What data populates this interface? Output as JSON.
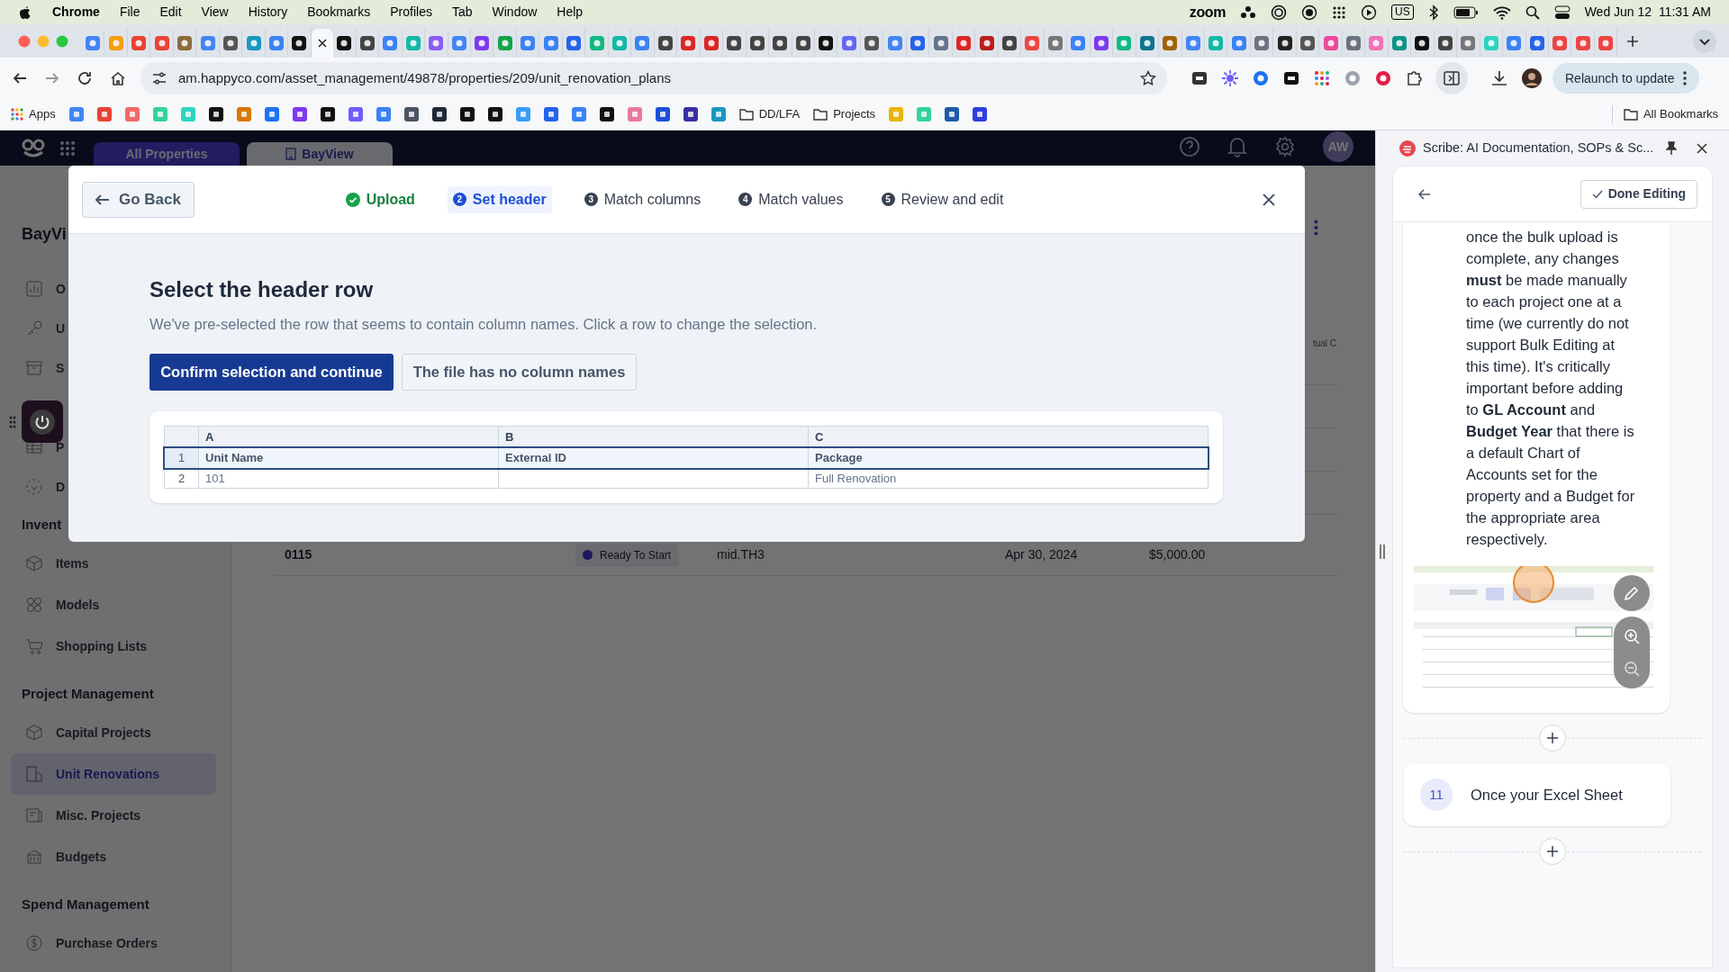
{
  "menu_bar": {
    "app": "Chrome",
    "items": [
      "File",
      "Edit",
      "View",
      "History",
      "Bookmarks",
      "Profiles",
      "Tab",
      "Window",
      "Help"
    ],
    "zoom": "zoom",
    "input_source": "US",
    "clock": "Wed Jun 12  11:31 AM"
  },
  "browser": {
    "tabs": [
      {
        "selected": false,
        "color": "#4285f4"
      },
      {
        "selected": false,
        "color": "#f59e0b"
      },
      {
        "selected": false,
        "color": "#ea4335"
      },
      {
        "selected": false,
        "color": "#ea4335"
      },
      {
        "selected": false,
        "color": "#8b6b3d"
      },
      {
        "selected": false,
        "color": "#4285f4"
      },
      {
        "selected": false,
        "color": "#555555"
      },
      {
        "selected": false,
        "color": "#1798c1"
      },
      {
        "selected": false,
        "color": "#3b82f6"
      },
      {
        "selected": false,
        "color": "#111111"
      },
      {
        "selected": true
      },
      {
        "selected": false,
        "color": "#111111"
      },
      {
        "selected": false,
        "color": "#444444"
      },
      {
        "selected": false,
        "color": "#3b82f6"
      },
      {
        "selected": false,
        "color": "#14b8a6"
      },
      {
        "selected": false,
        "color": "#8b5cf6"
      },
      {
        "selected": false,
        "color": "#4285f4"
      },
      {
        "selected": false,
        "color": "#7c3aed"
      },
      {
        "selected": false,
        "color": "#16a34a"
      },
      {
        "selected": false,
        "color": "#3b82f6"
      },
      {
        "selected": false,
        "color": "#3b82f6"
      },
      {
        "selected": false,
        "color": "#2563eb"
      },
      {
        "selected": false,
        "color": "#10b981"
      },
      {
        "selected": false,
        "color": "#14b8a6"
      },
      {
        "selected": false,
        "color": "#3b82f6"
      },
      {
        "selected": false,
        "color": "#444444"
      },
      {
        "selected": false,
        "color": "#dc2626"
      },
      {
        "selected": false,
        "color": "#dc2626"
      },
      {
        "selected": false,
        "color": "#444444"
      },
      {
        "selected": false,
        "color": "#444444"
      },
      {
        "selected": false,
        "color": "#444444"
      },
      {
        "selected": false,
        "color": "#444444"
      },
      {
        "selected": false,
        "color": "#111111"
      },
      {
        "selected": false,
        "color": "#6366f1"
      },
      {
        "selected": false,
        "color": "#555555"
      },
      {
        "selected": false,
        "color": "#4285f4"
      },
      {
        "selected": false,
        "color": "#2563eb"
      },
      {
        "selected": false,
        "color": "#64748b"
      },
      {
        "selected": false,
        "color": "#dc2626"
      },
      {
        "selected": false,
        "color": "#b91c1c"
      },
      {
        "selected": false,
        "color": "#444444"
      },
      {
        "selected": false,
        "color": "#ef4444"
      },
      {
        "selected": false,
        "color": "#777777"
      },
      {
        "selected": false,
        "color": "#3b82f6"
      },
      {
        "selected": false,
        "color": "#7c3aed"
      },
      {
        "selected": false,
        "color": "#10b981"
      },
      {
        "selected": false,
        "color": "#0e7490"
      },
      {
        "selected": false,
        "color": "#a16207"
      },
      {
        "selected": false,
        "color": "#4285f4"
      },
      {
        "selected": false,
        "color": "#14b8a6"
      },
      {
        "selected": false,
        "color": "#3b82f6"
      },
      {
        "selected": false,
        "color": "#6b7280"
      },
      {
        "selected": false,
        "color": "#222222"
      },
      {
        "selected": false,
        "color": "#555555"
      },
      {
        "selected": false,
        "color": "#ec4899"
      },
      {
        "selected": false,
        "color": "#6b7280"
      },
      {
        "selected": false,
        "color": "#f472b6"
      },
      {
        "selected": false,
        "color": "#0d9488"
      },
      {
        "selected": false,
        "color": "#111111"
      },
      {
        "selected": false,
        "color": "#444444"
      },
      {
        "selected": false,
        "color": "#777777"
      },
      {
        "selected": false,
        "color": "#2dd4bf"
      },
      {
        "selected": false,
        "color": "#3b82f6"
      },
      {
        "selected": false,
        "color": "#2563eb"
      },
      {
        "selected": false,
        "color": "#ef4444"
      },
      {
        "selected": false,
        "color": "#ef4444"
      },
      {
        "selected": false,
        "color": "#ef4444"
      }
    ],
    "url": "am.happyco.com/asset_management/49878/properties/209/unit_renovation_plans",
    "relaunch": "Relaunch to update",
    "bookmarks": [
      {
        "kind": "apps",
        "label": "Apps"
      },
      {
        "kind": "icon",
        "color": "#4285f4"
      },
      {
        "kind": "icon",
        "color": "#ea4335"
      },
      {
        "kind": "icon",
        "color": "#f06a6a"
      },
      {
        "kind": "icon",
        "color": "#34d399"
      },
      {
        "kind": "icon",
        "color": "#2dd4bf"
      },
      {
        "kind": "icon",
        "color": "#111111"
      },
      {
        "kind": "icon",
        "color": "#d97706"
      },
      {
        "kind": "icon",
        "color": "#1d72f3"
      },
      {
        "kind": "icon",
        "color": "#7c3aed"
      },
      {
        "kind": "icon",
        "color": "#111111"
      },
      {
        "kind": "icon",
        "color": "#6d5dfc"
      },
      {
        "kind": "icon",
        "color": "#3b82f6"
      },
      {
        "kind": "icon",
        "color": "#4b5563"
      },
      {
        "kind": "icon",
        "color": "#1f2937"
      },
      {
        "kind": "icon",
        "color": "#111111"
      },
      {
        "kind": "icon",
        "color": "#111111"
      },
      {
        "kind": "icon",
        "color": "#3b9df8"
      },
      {
        "kind": "icon",
        "color": "#2563eb"
      },
      {
        "kind": "icon",
        "color": "#3b82f6"
      },
      {
        "kind": "icon",
        "color": "#111111"
      },
      {
        "kind": "icon",
        "color": "#e879a0"
      },
      {
        "kind": "icon",
        "color": "#1d4ed8"
      },
      {
        "kind": "icon",
        "color": "#3730a3"
      },
      {
        "kind": "icon",
        "color": "#1798c1"
      },
      {
        "kind": "folder",
        "label": "DD/LFA"
      },
      {
        "kind": "folder",
        "label": "Projects"
      },
      {
        "kind": "icon",
        "color": "#eab308"
      },
      {
        "kind": "icon",
        "color": "#34d399"
      },
      {
        "kind": "icon",
        "color": "#1e5aa8"
      },
      {
        "kind": "icon",
        "color": "#2f3de0"
      }
    ],
    "all_bookmarks": "All Bookmarks"
  },
  "app": {
    "property_tabs": [
      {
        "label": "All Properties",
        "selected": true
      },
      {
        "label": "BayView",
        "selected": false
      }
    ],
    "avatar": "AW",
    "sidebar": {
      "title": "BayVi",
      "sections": [
        {
          "items": [
            {
              "label": "O",
              "selected": false
            },
            {
              "label": "U",
              "selected": false
            },
            {
              "label": "S",
              "selected": false
            },
            {
              "label": "P",
              "selected": false
            },
            {
              "label": "D",
              "selected": false
            }
          ]
        },
        {
          "heading": "Invent",
          "items": [
            {
              "label": "Items",
              "selected": false
            },
            {
              "label": "Models",
              "selected": false
            },
            {
              "label": "Shopping Lists",
              "selected": false
            }
          ]
        },
        {
          "heading": "Project Management",
          "items": [
            {
              "label": "Capital Projects",
              "selected": false
            },
            {
              "label": "Unit Renovations",
              "selected": true
            },
            {
              "label": "Misc. Projects",
              "selected": false
            },
            {
              "label": "Budgets",
              "selected": false
            }
          ]
        },
        {
          "heading": "Spend Management",
          "items": [
            {
              "label": "Purchase Orders",
              "selected": false
            }
          ]
        }
      ]
    },
    "table": {
      "column_fragment": "tual C",
      "row": {
        "unit": "0115",
        "status": "Ready To Start",
        "package": "mid.TH3",
        "date": "Apr 30, 2024",
        "amount": "$5,000.00"
      }
    }
  },
  "modal": {
    "back": "Go Back",
    "steps": [
      {
        "label": "Upload",
        "done": true,
        "selected": false
      },
      {
        "number": "2",
        "label": "Set header",
        "done": false,
        "selected": true
      },
      {
        "number": "3",
        "label": "Match columns",
        "done": false,
        "selected": false
      },
      {
        "number": "4",
        "label": "Match values",
        "done": false,
        "selected": false
      },
      {
        "number": "5",
        "label": "Review and edit",
        "done": false,
        "selected": false
      }
    ],
    "title": "Select the header row",
    "description": "We've pre-selected the row that seems to contain column names. Click a row to change the selection.",
    "primary_button": "Confirm selection and continue",
    "secondary_button": "The file has no column names",
    "columns": [
      "A",
      "B",
      "C"
    ],
    "rows": [
      {
        "number": "1",
        "cells": [
          "Unit Name",
          "External ID",
          "Package"
        ],
        "selected": true
      },
      {
        "number": "2",
        "cells": [
          "101",
          null,
          "Full Renovation"
        ],
        "selected": false
      }
    ]
  },
  "scribe": {
    "title": "Scribe: AI Documentation, SOPs & Sc...",
    "done": "Done Editing",
    "paragraph": "once the bulk upload is complete, any changes **must** be made manually to each project one at a time (we currently do not support Bulk Editing at this time). It's critically important before adding to **GL Account** and **Budget Year** that there is a default Chart of Accounts set for the property and a Budget for the appropriate area respectively.",
    "next_step": {
      "number": "11",
      "text": "Once your Excel Sheet"
    }
  }
}
